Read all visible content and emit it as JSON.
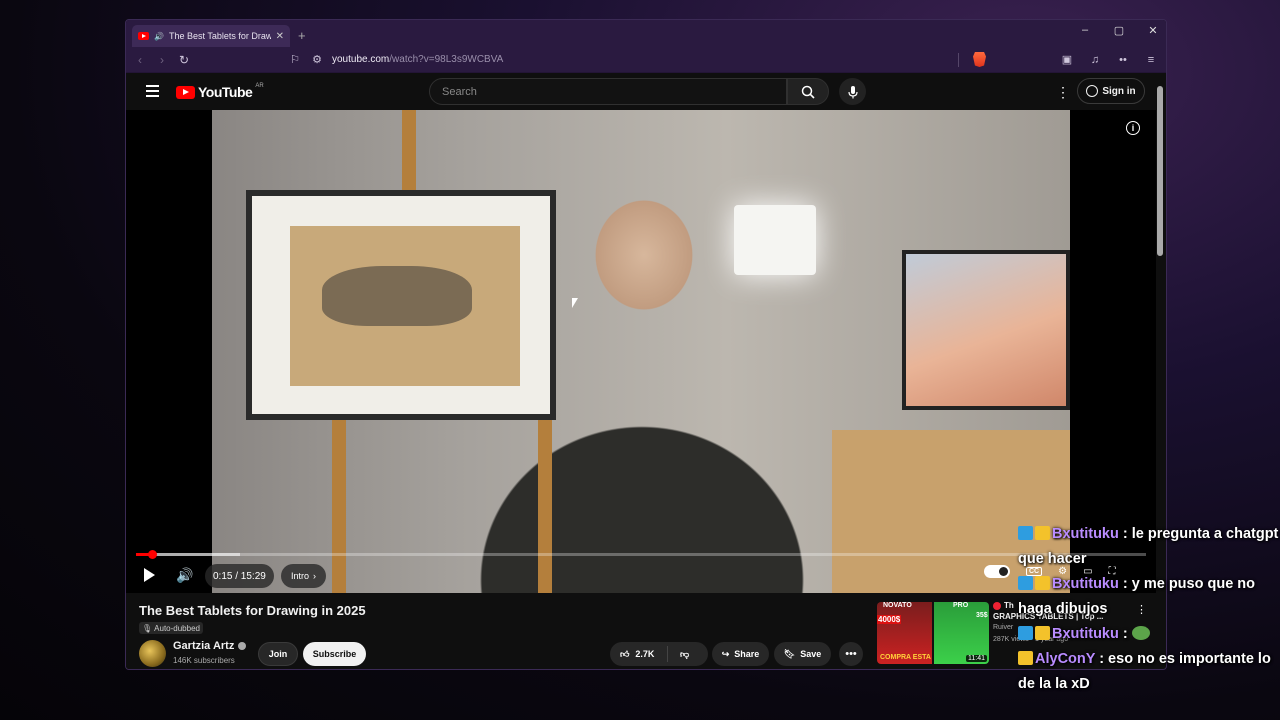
{
  "browser": {
    "tab_title": "The Best Tablets for Drawing",
    "new_tab": "+",
    "url_host": "youtube.com",
    "url_path": "/watch?v=98L3s9WCBVA",
    "min": "–",
    "max": "▢",
    "close": "✕"
  },
  "youtube": {
    "logo_text": "YouTube",
    "country_code": "AR",
    "search_placeholder": "Search",
    "signin_label": "Sign in",
    "accent": "#ff0000"
  },
  "player": {
    "time": "0:15 / 15:29",
    "chapter": "Intro",
    "progress_fraction": 0.016
  },
  "video": {
    "title": "The Best Tablets for Drawing in 2025",
    "dubbed": "Auto-dubbed",
    "channel": "Gartzia Artz",
    "subscribers": "146K subscribers",
    "join_label": "Join",
    "subscribe_label": "Subscribe",
    "likes": "2.7K",
    "share_label": "Share",
    "save_label": "Save"
  },
  "recommended": {
    "title": "Th",
    "subtitle": "GRAPHICS TABLETS | Top ...",
    "channel": "Ruiver",
    "meta": "287K views · 1 year ago",
    "duration": "11:41",
    "thumb_left": "NOVATO",
    "thumb_right": "PRO",
    "thumb_bottom": "COMPRA ESTA",
    "thumb_price": "4000$",
    "thumb_price2": "35$"
  },
  "chat": [
    {
      "user": "Bxutituku",
      "message": ": le pregunta a chatgpt que hacer"
    },
    {
      "user": "Bxutituku",
      "message": ": y me puso que no haga dibujos"
    },
    {
      "user": "Bxutituku",
      "message": ":"
    },
    {
      "user": "AlyConY",
      "message": ": eso no es importante lo de la la xD"
    }
  ]
}
